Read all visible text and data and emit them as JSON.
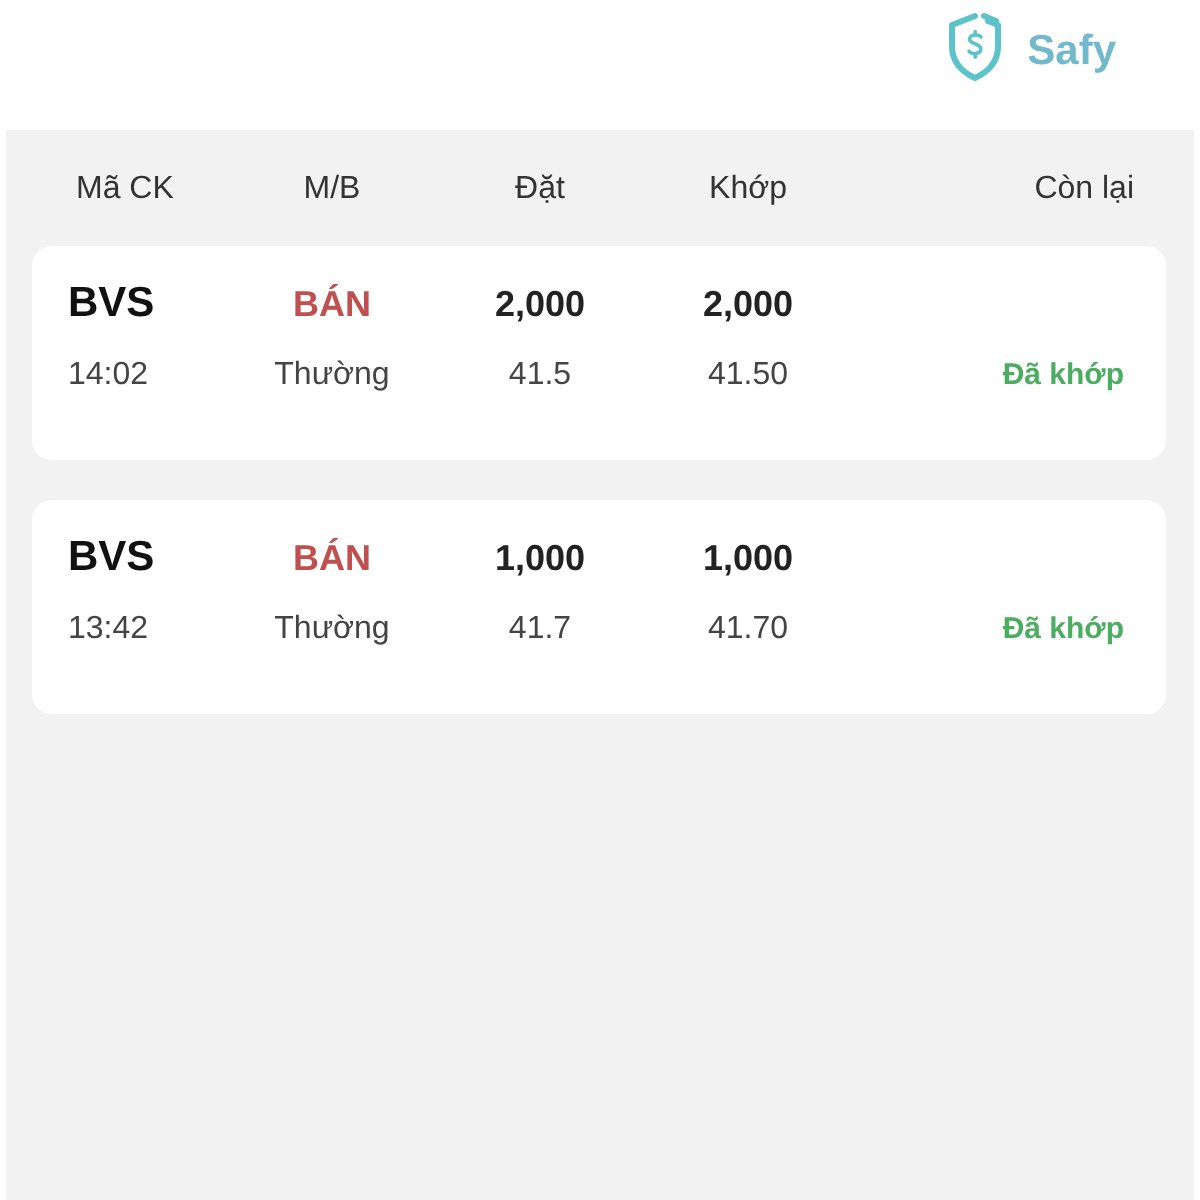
{
  "header": {
    "logo_text": "Safy"
  },
  "columns": [
    "Mã CK",
    "M/B",
    "Đặt",
    "Khớp",
    "Còn lại"
  ],
  "orders": [
    {
      "symbol": "BVS",
      "side": {
        "text": "BÁN",
        "color": "#c0504f"
      },
      "quantity": "2,000",
      "matched_quantity": "2,000",
      "time": "14:02",
      "order_type": "Thường",
      "price": "41.5",
      "matched_price": "41.50",
      "status": {
        "text": "Đã khớp",
        "color": "#4cad62"
      }
    },
    {
      "symbol": "BVS",
      "side": {
        "text": "BÁN",
        "color": "#c0504f"
      },
      "quantity": "1,000",
      "matched_quantity": "1,000",
      "time": "13:42",
      "order_type": "Thường",
      "price": "41.7",
      "matched_price": "41.70",
      "status": {
        "text": "Đã khớp",
        "color": "#4cad62"
      }
    }
  ]
}
